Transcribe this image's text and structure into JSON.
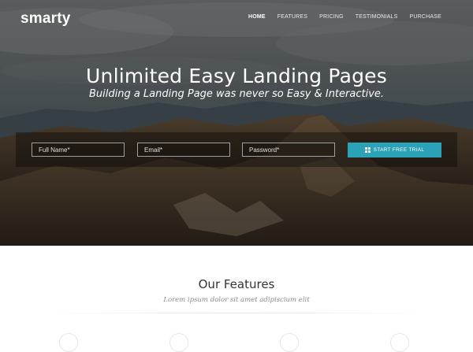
{
  "brand": {
    "logo": "smarty"
  },
  "nav": {
    "items": [
      {
        "label": "HOME",
        "active": true
      },
      {
        "label": "FEATURES",
        "active": false
      },
      {
        "label": "PRICING",
        "active": false
      },
      {
        "label": "TESTIMONIALS",
        "active": false
      },
      {
        "label": "PURCHASE",
        "active": false
      }
    ]
  },
  "hero": {
    "title": "Unlimited Easy Landing Pages",
    "subtitle": "Building a Landing Page was never so Easy & Interactive."
  },
  "form": {
    "full_name_placeholder": "Full Name*",
    "email_placeholder": "Email*",
    "password_placeholder": "Password*",
    "cta_label": "START FREE TRIAL",
    "cta_icon": "grid-icon"
  },
  "features": {
    "title": "Our Features",
    "subtitle": "Lorem ipsum dolor sit amet adipiscium elit"
  },
  "colors": {
    "accent": "#2aa2b7",
    "text_dark": "#333333",
    "text_muted": "#8a8a8a"
  }
}
